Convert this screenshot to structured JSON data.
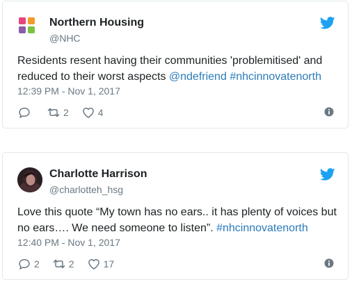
{
  "tweets": [
    {
      "author_name": "Northern Housing",
      "handle": "@NHC",
      "avatar": "nhc-logo",
      "text_plain": "Residents resent having their communities 'problemitised' and reduced to their worst aspects ",
      "mention": "@ndefriend",
      "hashtag": "#nhcinnovatenorth",
      "timestamp": "12:39 PM - Nov 1, 2017",
      "reply_count": "",
      "retweet_count": "2",
      "like_count": "4"
    },
    {
      "author_name": "Charlotte Harrison",
      "handle": "@charlotteh_hsg",
      "avatar": "profile-photo",
      "text_plain": "Love this quote “My town has no ears.. it has plenty of voices but no ears…. We need someone to listen”. ",
      "hashtag": "#nhcinnovatenorth",
      "timestamp": "12:40 PM - Nov 1, 2017",
      "reply_count": "2",
      "retweet_count": "2",
      "like_count": "17"
    }
  ],
  "colors": {
    "twitter_blue": "#1da1f2",
    "link": "#2b7bb9",
    "muted": "#697882",
    "border": "#e1e8ed",
    "logo_pink": "#e8457a",
    "logo_orange": "#f29a2e",
    "logo_purple": "#8b5ca8",
    "logo_green": "#7cc242"
  },
  "icons": [
    "twitter-bird-icon",
    "reply-icon",
    "retweet-icon",
    "like-icon",
    "info-icon"
  ]
}
